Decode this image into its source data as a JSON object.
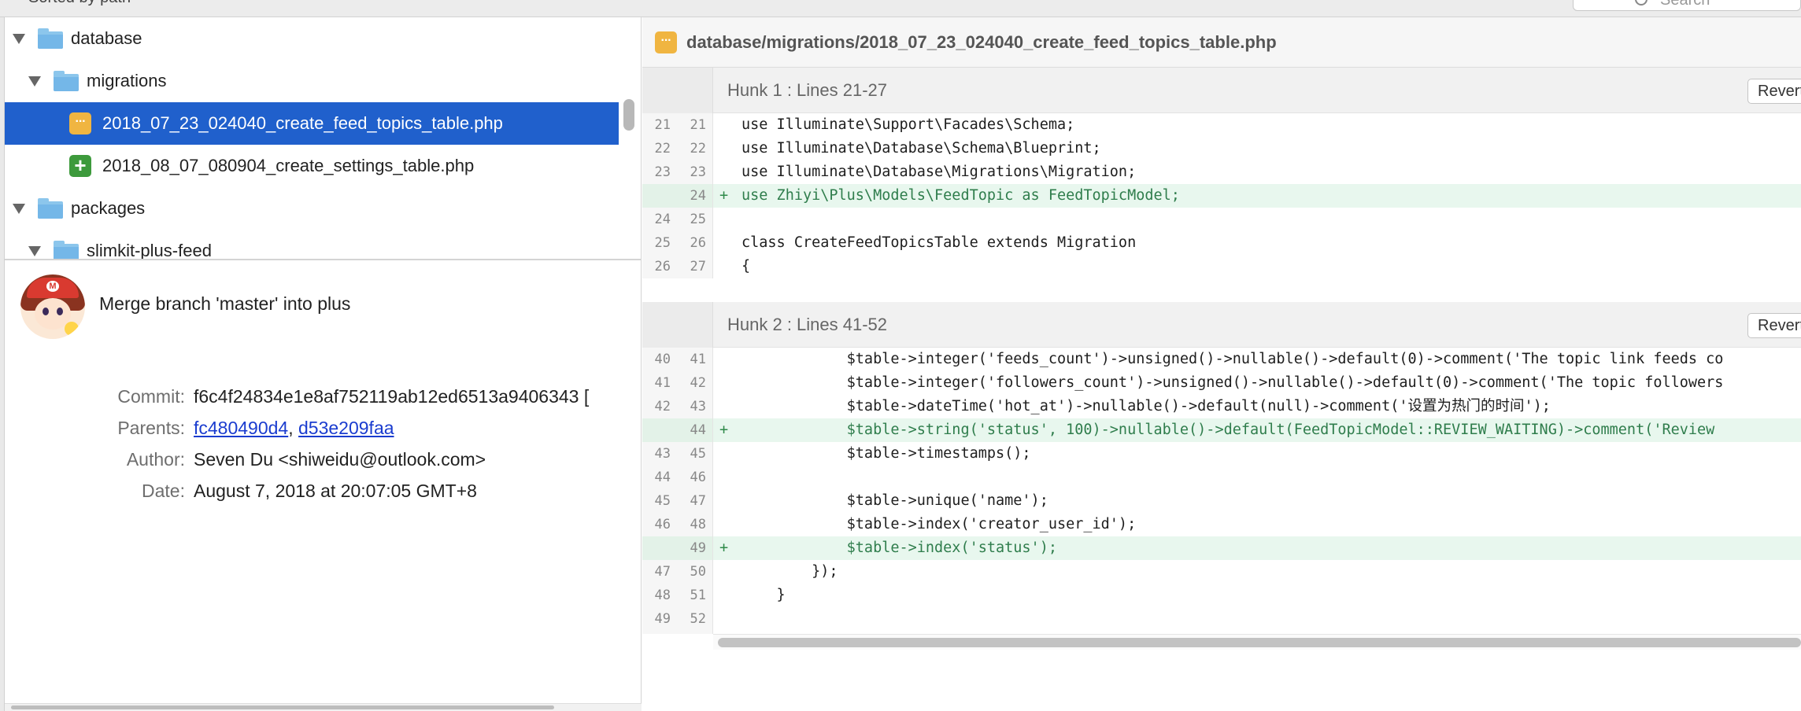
{
  "toolbar": {
    "sorted_label": "Sorted by path",
    "search_placeholder": "Search"
  },
  "tree": {
    "items": [
      {
        "label": "database",
        "kind": "folder",
        "expanded": true
      },
      {
        "label": "migrations",
        "kind": "folder",
        "expanded": true
      },
      {
        "label": "2018_07_23_024040_create_feed_topics_table.php",
        "kind": "file",
        "status": "modified",
        "selected": true
      },
      {
        "label": "2018_08_07_080904_create_settings_table.php",
        "kind": "file",
        "status": "added",
        "selected": false
      },
      {
        "label": "packages",
        "kind": "folder",
        "expanded": true
      },
      {
        "label": "slimkit-plus-feed",
        "kind": "folder",
        "expanded": true
      }
    ]
  },
  "commit": {
    "subject": "Merge branch 'master' into plus",
    "commit_label": "Commit:",
    "commit_hash": "f6c4f24834e1e8af752119ab12ed6513a9406343 [",
    "parents_label": "Parents:",
    "parent_1": "fc480490d4",
    "parent_sep": ",",
    "parent_2": "d53e209faa",
    "author_label": "Author:",
    "author": "Seven Du <shiweidu@outlook.com>",
    "date_label": "Date:",
    "date": "August 7, 2018 at 20:07:05 GMT+8"
  },
  "diff": {
    "file_path": "database/migrations/2018_07_23_024040_create_feed_topics_table.php",
    "revert_label": "Revert",
    "hunks": [
      {
        "title": "Hunk 1 : Lines 21-27",
        "lines": [
          {
            "old": "21",
            "new": "21",
            "type": "ctx",
            "text": "use Illuminate\\Support\\Facades\\Schema;"
          },
          {
            "old": "22",
            "new": "22",
            "type": "ctx",
            "text": "use Illuminate\\Database\\Schema\\Blueprint;"
          },
          {
            "old": "23",
            "new": "23",
            "type": "ctx",
            "text": "use Illuminate\\Database\\Migrations\\Migration;"
          },
          {
            "old": "",
            "new": "24",
            "type": "add",
            "text": "use Zhiyi\\Plus\\Models\\FeedTopic as FeedTopicModel;"
          },
          {
            "old": "24",
            "new": "25",
            "type": "ctx",
            "text": ""
          },
          {
            "old": "25",
            "new": "26",
            "type": "ctx",
            "text": "class CreateFeedTopicsTable extends Migration"
          },
          {
            "old": "26",
            "new": "27",
            "type": "ctx",
            "text": "{"
          }
        ]
      },
      {
        "title": "Hunk 2 : Lines 41-52",
        "lines": [
          {
            "old": "40",
            "new": "41",
            "type": "ctx",
            "text": "            $table->integer('feeds_count')->unsigned()->nullable()->default(0)->comment('The topic link feeds co"
          },
          {
            "old": "41",
            "new": "42",
            "type": "ctx",
            "text": "            $table->integer('followers_count')->unsigned()->nullable()->default(0)->comment('The topic followers"
          },
          {
            "old": "42",
            "new": "43",
            "type": "ctx",
            "text": "            $table->dateTime('hot_at')->nullable()->default(null)->comment('设置为热门的时间');"
          },
          {
            "old": "",
            "new": "44",
            "type": "add",
            "text": "            $table->string('status', 100)->nullable()->default(FeedTopicModel::REVIEW_WAITING)->comment('Review"
          },
          {
            "old": "43",
            "new": "45",
            "type": "ctx",
            "text": "            $table->timestamps();"
          },
          {
            "old": "44",
            "new": "46",
            "type": "ctx",
            "text": ""
          },
          {
            "old": "45",
            "new": "47",
            "type": "ctx",
            "text": "            $table->unique('name');"
          },
          {
            "old": "46",
            "new": "48",
            "type": "ctx",
            "text": "            $table->index('creator_user_id');"
          },
          {
            "old": "",
            "new": "49",
            "type": "add",
            "text": "            $table->index('status');"
          },
          {
            "old": "47",
            "new": "50",
            "type": "ctx",
            "text": "        });"
          },
          {
            "old": "48",
            "new": "51",
            "type": "ctx",
            "text": "    }"
          },
          {
            "old": "49",
            "new": "52",
            "type": "ctx",
            "text": ""
          }
        ]
      }
    ]
  }
}
